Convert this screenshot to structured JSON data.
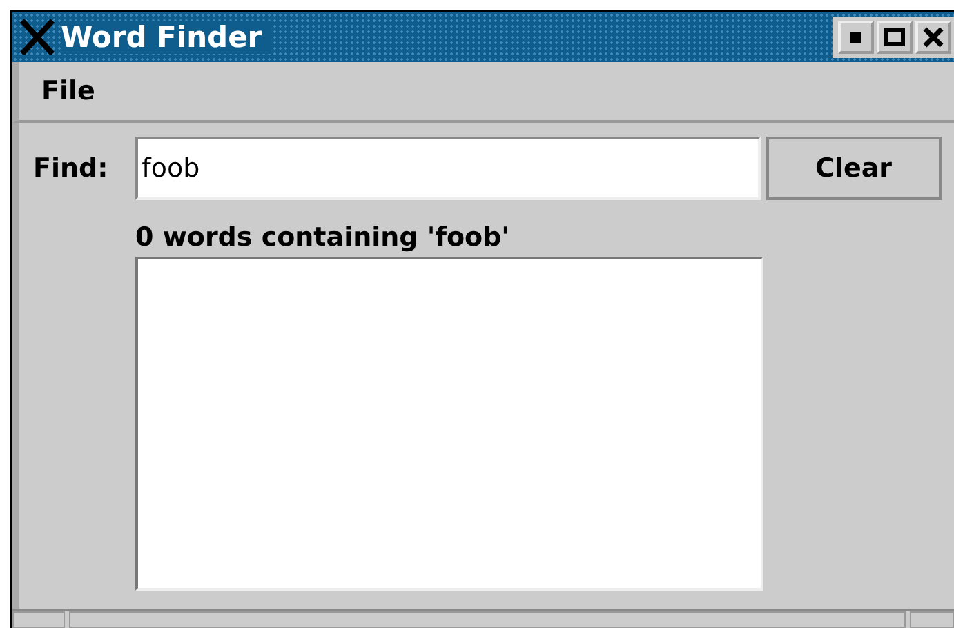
{
  "window": {
    "title": "Word Finder"
  },
  "menu": [
    "File"
  ],
  "find": {
    "label": "Find:",
    "value": "foob"
  },
  "buttons": [
    "Clear"
  ],
  "status": "0 words containing 'foob'"
}
